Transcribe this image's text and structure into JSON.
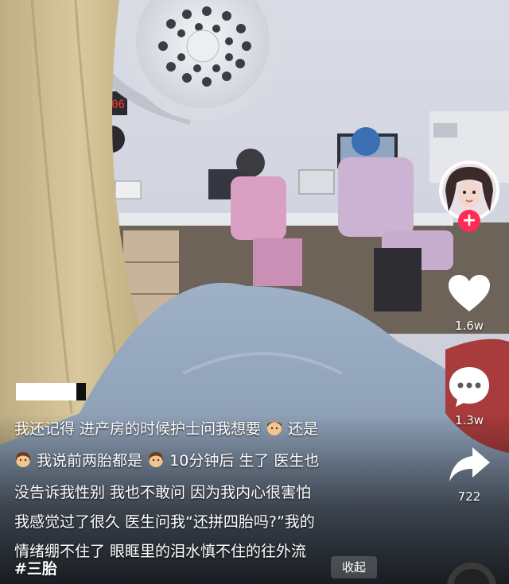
{
  "caption": {
    "lines": [
      "我还记得 进产房的时候护士问我想要",
      "还是",
      "我说前两胎都是",
      "10分钟后 生了 医生也",
      "没告诉我性别 我也不敢问 因为我内心很害怕",
      "我感觉过了很久 医生问我“还拼四胎吗?”我的",
      "情绪绷不住了 眼眶里的泪水慎不住的往外流"
    ],
    "hashtag": "#三胎",
    "collapse_label": "收起"
  },
  "clock_display": "41:06",
  "actions": {
    "likes": "1.6w",
    "comments": "1.3w",
    "shares": "722",
    "follow_symbol": "+"
  },
  "colors": {
    "follow": "#fe2c55",
    "caption_text": "#ffffff",
    "like_heart": "#ffffff"
  },
  "icons": [
    "heart-icon",
    "comment-icon",
    "share-icon",
    "follow-plus-icon",
    "boy-emoji-icon",
    "girl-emoji-icon",
    "music-disc-icon"
  ]
}
